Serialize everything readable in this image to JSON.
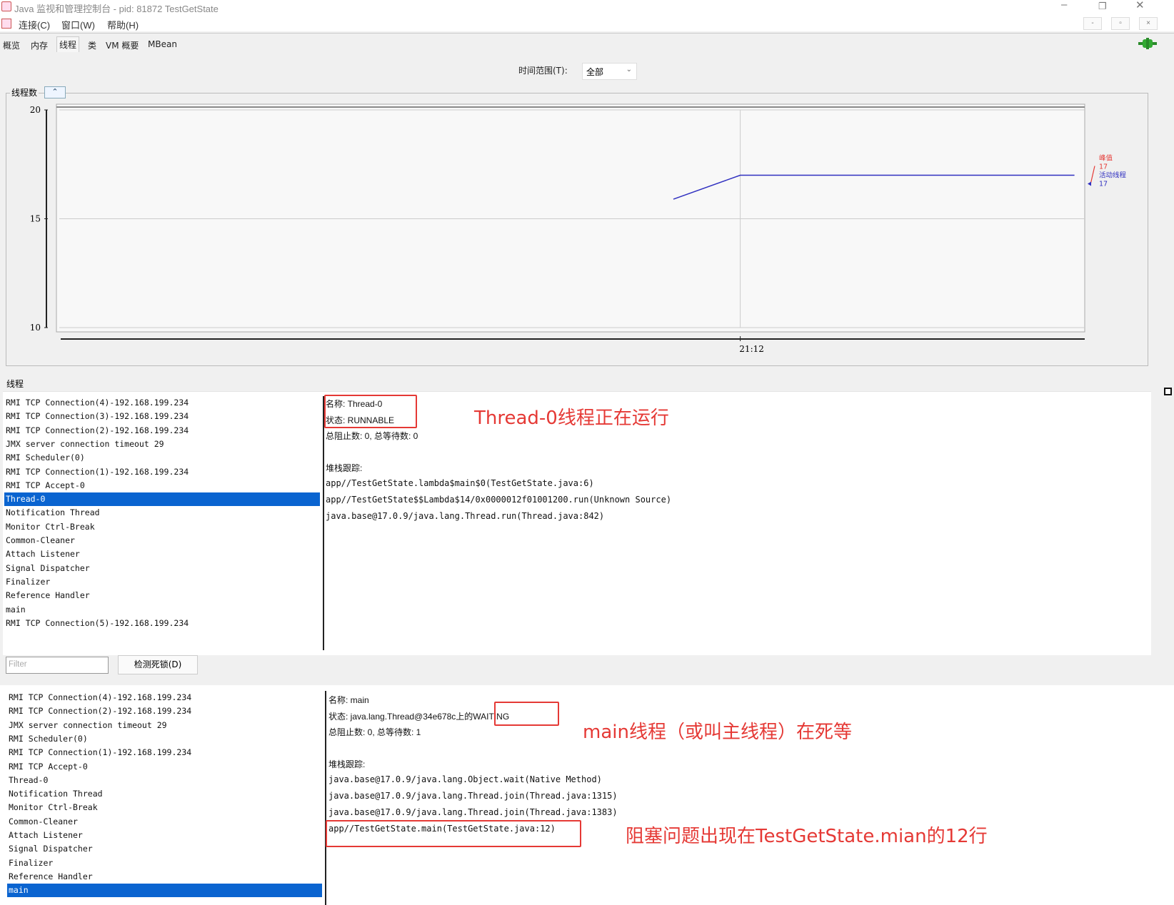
{
  "window": {
    "title": "Java 监视和管理控制台 - pid: 81872 TestGetState",
    "min": "–",
    "max": "❐",
    "close": "✕"
  },
  "menu": {
    "items": [
      "连接(C)",
      "窗口(W)",
      "帮助(H)"
    ],
    "small_buttons": [
      "-",
      "▫",
      "×"
    ]
  },
  "tabs": [
    "概览",
    "内存",
    "线程",
    "类",
    "VM 概要",
    "MBean"
  ],
  "active_tab": "线程",
  "time_range": {
    "label": "时间范围(T):",
    "value": "全部"
  },
  "chart_data": {
    "type": "line",
    "box_label": "线程数",
    "ylim": [
      10,
      20
    ],
    "yticks": [
      10,
      15,
      20
    ],
    "xticks": [
      "21:12"
    ],
    "series": [
      {
        "name": "峰值",
        "color": "#e53935",
        "values": [
          17
        ],
        "label_value": "17"
      },
      {
        "name": "活动线程",
        "color": "#3030c0",
        "x": [
          0.6,
          0.665,
          0.685,
          0.99
        ],
        "values": [
          15.9,
          17,
          17,
          17
        ],
        "label_value": "17"
      }
    ]
  },
  "threads_label": "线程",
  "panel1": {
    "threads": [
      "RMI TCP Connection(4)-192.168.199.234",
      "RMI TCP Connection(3)-192.168.199.234",
      "RMI TCP Connection(2)-192.168.199.234",
      "JMX server connection timeout 29",
      "RMI Scheduler(0)",
      "RMI TCP Connection(1)-192.168.199.234",
      "RMI TCP Accept-0",
      "Thread-0",
      "Notification Thread",
      "Monitor Ctrl-Break",
      "Common-Cleaner",
      "Attach Listener",
      "Signal Dispatcher",
      "Finalizer",
      "Reference Handler",
      "main",
      "RMI TCP Connection(5)-192.168.199.234"
    ],
    "selected_index": 7,
    "detail": {
      "name": "名称: Thread-0",
      "state": "状态: RUNNABLE",
      "counts": "总阻止数: 0, 总等待数: 0",
      "stack_label": "堆栈跟踪:",
      "stack": [
        "app//TestGetState.lambda$main$0(TestGetState.java:6)",
        "app//TestGetState$$Lambda$14/0x0000012f01001200.run(Unknown Source)",
        "java.base@17.0.9/java.lang.Thread.run(Thread.java:842)"
      ]
    },
    "annotation": "Thread-0线程正在运行"
  },
  "filter": {
    "placeholder": "Filter",
    "button": "检测死锁(D)"
  },
  "panel2": {
    "threads": [
      "RMI TCP Connection(4)-192.168.199.234",
      "RMI TCP Connection(2)-192.168.199.234",
      "JMX server connection timeout 29",
      "RMI Scheduler(0)",
      "RMI TCP Connection(1)-192.168.199.234",
      "RMI TCP Accept-0",
      "Thread-0",
      "Notification Thread",
      "Monitor Ctrl-Break",
      "Common-Cleaner",
      "Attach Listener",
      "Signal Dispatcher",
      "Finalizer",
      "Reference Handler",
      "main"
    ],
    "selected_index": 14,
    "detail": {
      "name": "名称: main",
      "state_prefix": "状态: java.lang.Thread@34e678c上",
      "state_suffix": "的WAITING",
      "counts": "总阻止数: 0, 总等待数: 1",
      "stack_label": "堆栈跟踪:",
      "stack": [
        "java.base@17.0.9/java.lang.Object.wait(Native Method)",
        "java.base@17.0.9/java.lang.Thread.join(Thread.java:1315)",
        "java.base@17.0.9/java.lang.Thread.join(Thread.java:1383)",
        "app//TestGetState.main(TestGetState.java:12)"
      ]
    },
    "annotation_state": "main线程（或叫主线程）在死等",
    "annotation_stack": "阻塞问题出现在TestGetState.mian的12行"
  }
}
